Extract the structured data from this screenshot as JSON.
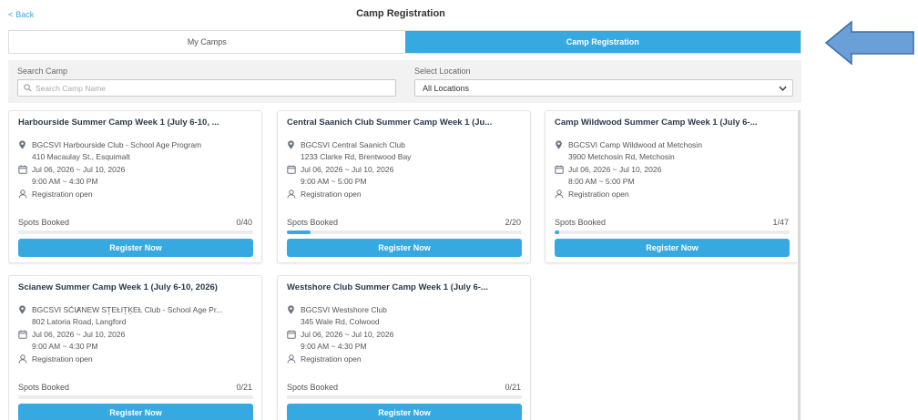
{
  "header": {
    "back_label": "Back",
    "title": "Camp Registration"
  },
  "tabs": [
    {
      "label": "My Camps",
      "active": false
    },
    {
      "label": "Camp Registration",
      "active": true
    }
  ],
  "filters": {
    "search_label": "Search Camp",
    "search_placeholder": "Search Camp Name",
    "location_label": "Select Location",
    "location_value": "All Locations"
  },
  "camps": [
    {
      "title": "Harbourside Summer Camp Week 1 (July 6-10, ...",
      "location_name": "BGCSVI Harbourside Club - School Age Program",
      "address": "410 Macaulay St., Esquimalt",
      "dates": "Jul 06, 2026 ~ Jul 10, 2026",
      "time": "9:00 AM ~ 4:30 PM",
      "status": "Registration open",
      "spots_label": "Spots Booked",
      "spots_text": "0/40",
      "booked": 0,
      "capacity": 40,
      "button_label": "Register Now"
    },
    {
      "title": "Central Saanich Club Summer Camp Week 1 (Ju...",
      "location_name": "BGCSVI Central Saanich Club",
      "address": "1233 Clarke Rd, Brentwood Bay",
      "dates": "Jul 06, 2026 ~ Jul 10, 2026",
      "time": "9:00 AM ~ 5:00 PM",
      "status": "Registration open",
      "spots_label": "Spots Booked",
      "spots_text": "2/20",
      "booked": 2,
      "capacity": 20,
      "button_label": "Register Now"
    },
    {
      "title": "Camp Wildwood Summer Camp Week 1 (July 6-...",
      "location_name": "BGCSVI Camp Wildwood at Metchosin",
      "address": "3900 Metchosin Rd, Metchosin",
      "dates": "Jul 06, 2026 ~ Jul 10, 2026",
      "time": "8:00 AM ~ 5:00 PM",
      "status": "Registration open",
      "spots_label": "Spots Booked",
      "spots_text": "1/47",
      "booked": 1,
      "capacity": 47,
      "button_label": "Register Now"
    },
    {
      "title": "Scianew Summer Camp Week 1 (July 6-10, 2026)",
      "location_name": "BGCSVI SĆIȺNEW SṮEȽIṮḴEȽ Club - School Age Pr...",
      "address": "802 Latoria Road, Langford",
      "dates": "Jul 06, 2026 ~ Jul 10, 2026",
      "time": "9:00 AM ~ 4:30 PM",
      "status": "Registration open",
      "spots_label": "Spots Booked",
      "spots_text": "0/21",
      "booked": 0,
      "capacity": 21,
      "button_label": "Register Now"
    },
    {
      "title": "Westshore Club Summer Camp Week 1 (July 6-...",
      "location_name": "BGCSVI Westshore Club",
      "address": "345 Wale Rd, Colwood",
      "dates": "Jul 06, 2026 ~ Jul 10, 2026",
      "time": "9:00 AM ~ 4:30 PM",
      "status": "Registration open",
      "spots_label": "Spots Booked",
      "spots_text": "0/21",
      "booked": 0,
      "capacity": 21,
      "button_label": "Register Now"
    }
  ],
  "colors": {
    "accent": "#36a9e1",
    "arrow_fill": "#6a9fd8",
    "arrow_stroke": "#3b6ea8"
  }
}
